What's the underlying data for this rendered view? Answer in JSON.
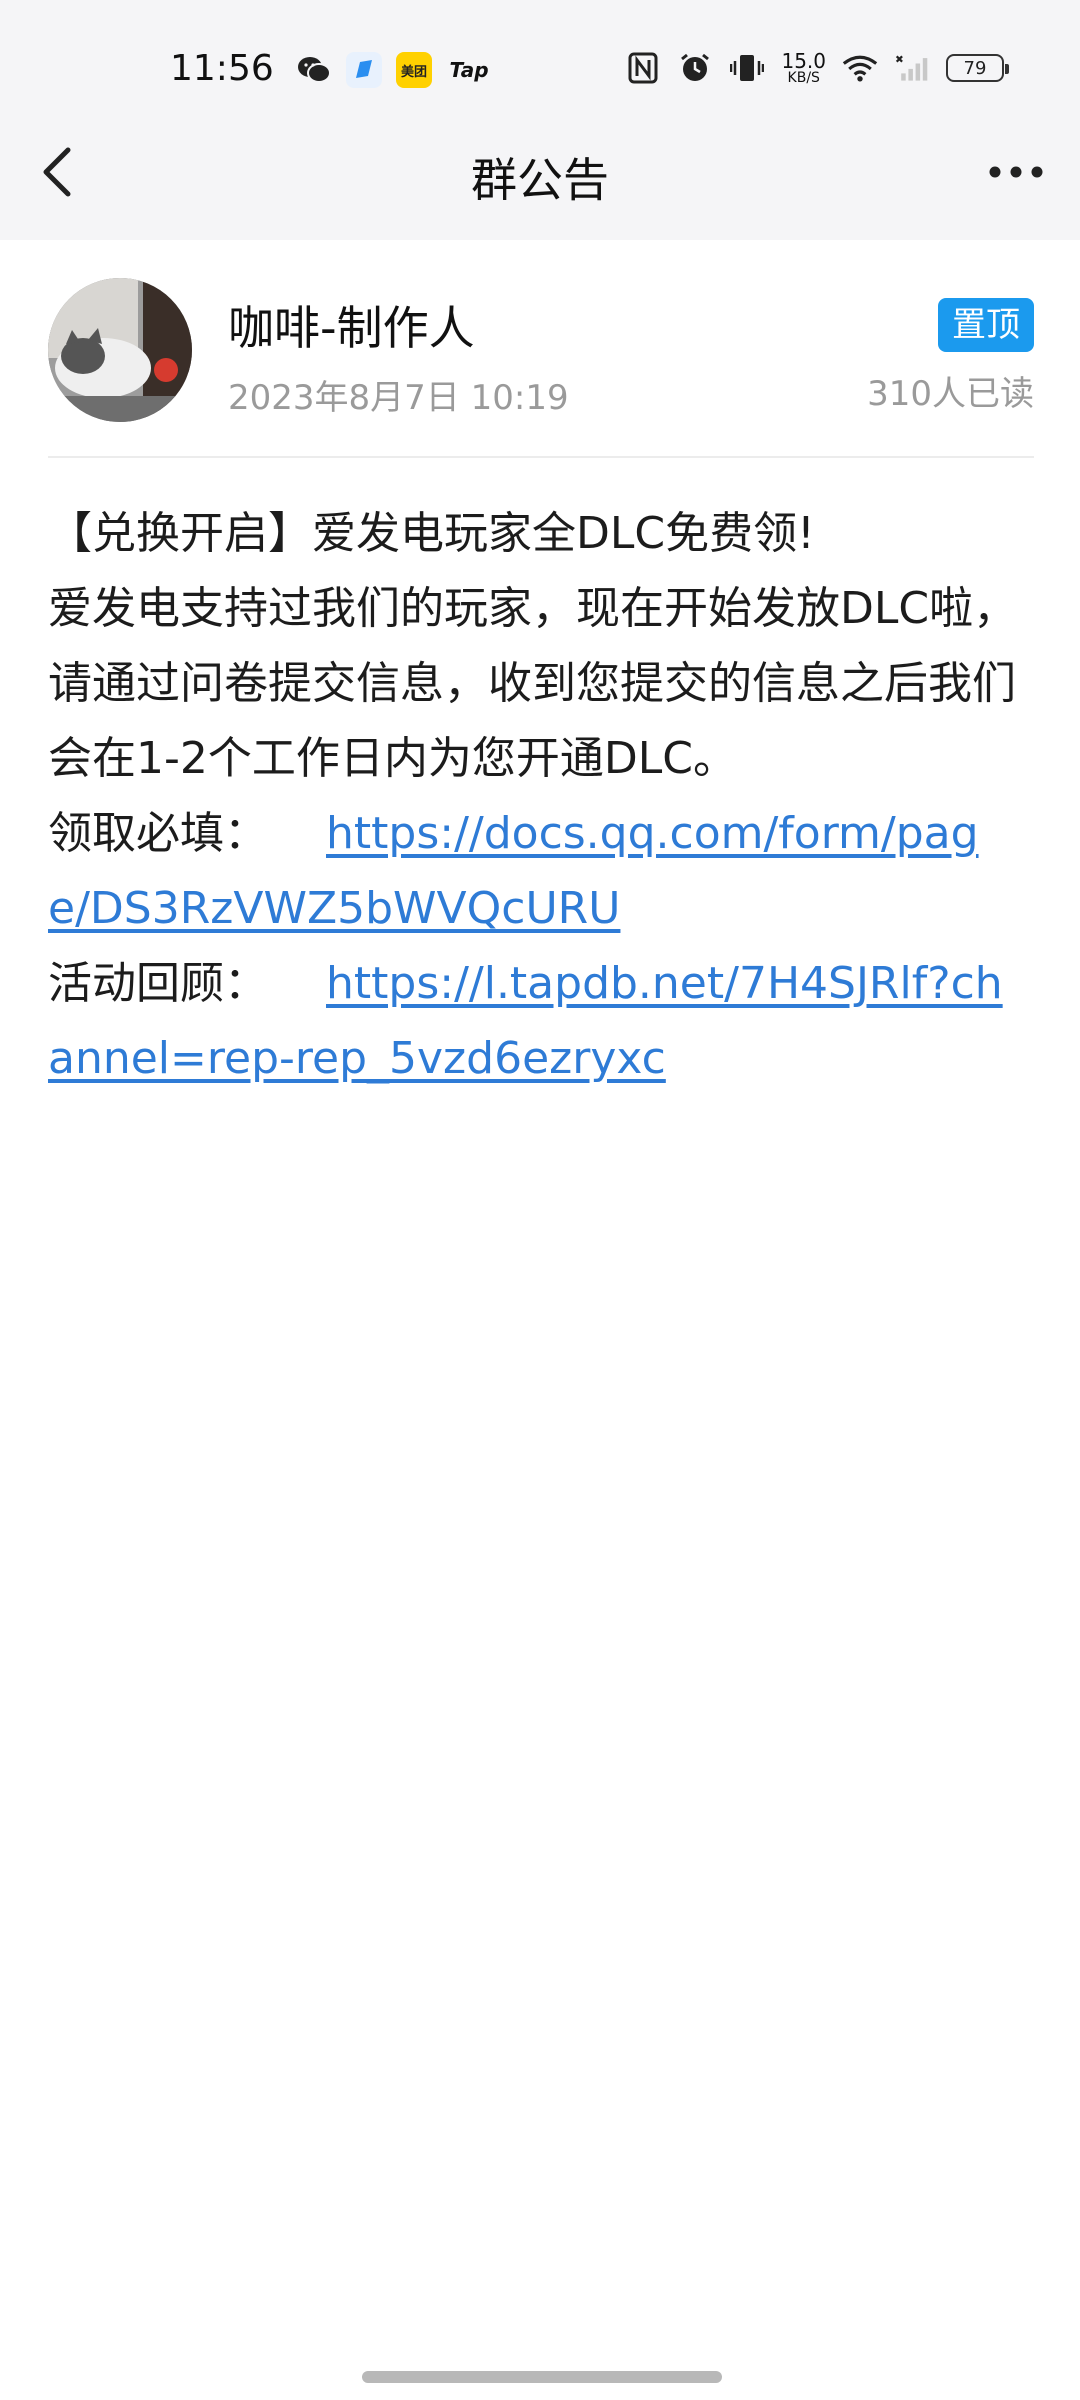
{
  "status_bar": {
    "time": "11:56",
    "notification_icons": [
      "wechat-icon",
      "browser-icon",
      "meituan-icon",
      "taptap-icon"
    ],
    "meituan_label": "美团",
    "tap_label": "Tap",
    "net_speed_value": "15.0",
    "net_speed_unit": "KB/S",
    "battery_level": "79"
  },
  "nav": {
    "title": "群公告"
  },
  "post": {
    "author": "咖啡-制作人",
    "timestamp": "2023年8月7日 10:19",
    "pin_label": "置顶",
    "read_count": "310人已读"
  },
  "notice": {
    "line1": "【兑换开启】爱发电玩家全DLC免费领!",
    "line2": "爱发电支持过我们的玩家，现在开始发放DLC啦，请通过问卷提交信息，收到您提交的信息之后我们会在1-2个工作日内为您开通DLC。",
    "form_label": "领取必填：",
    "form_link": "https://docs.qq.com/form/page/DS3RzVWZ5bWVQcURU",
    "review_label": "活动回顾：",
    "review_link": "https://l.tapdb.net/7H4SJRlf?channel=rep-rep_5vzd6ezryxc"
  },
  "colors": {
    "link": "#2e7bd6",
    "pin_badge": "#1b9aee",
    "secondary_text": "#9a9a9a"
  }
}
